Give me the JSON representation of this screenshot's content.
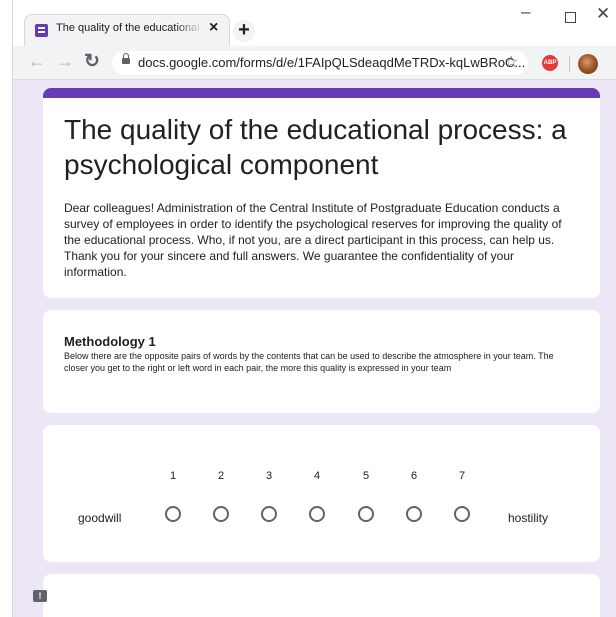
{
  "browser": {
    "tab_title": "The quality of the educational process: a psychological component",
    "url": "docs.google.com/forms/d/e/1FAIpQLSdeaqdMeTRDx-kqLwBRoC..."
  },
  "form": {
    "title": "The quality of the educational process: a psychological component",
    "description": "Dear colleagues! Administration of the Central Institute of Postgraduate Education conducts a survey of employees in order to identify the psychological reserves for improving the quality of the educational process. Who, if not you, are a direct participant in this process, can help us. Thank you for your sincere and full answers. We guarantee the confidentiality of your information.",
    "accent_color": "#673ab7",
    "section": {
      "title": "Methodology 1",
      "description": "Below there are the opposite  pairs of words by the contents that can be used to describe the atmosphere in your team. The closer you get to the right or left word in each pair, the more this quality is expressed in your team"
    },
    "question": {
      "low_label": "goodwill",
      "high_label": "hostility",
      "scale": [
        "1",
        "2",
        "3",
        "4",
        "5",
        "6",
        "7"
      ]
    }
  }
}
